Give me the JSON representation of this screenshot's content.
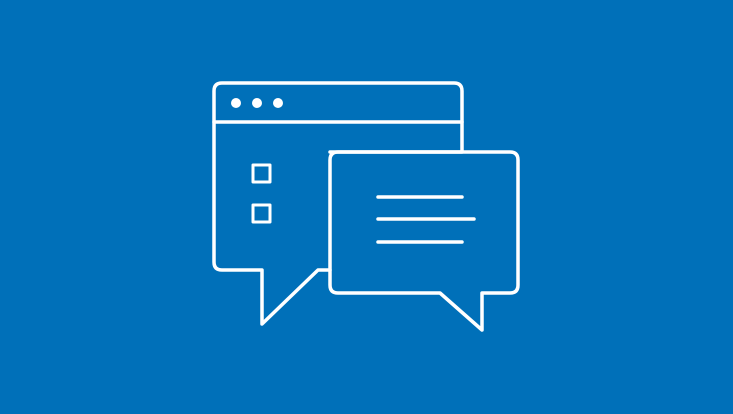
{
  "background_color": "#0070B9",
  "line_color": "#FFFFFF",
  "icon": "browser-window-and-chat-bubble-icon"
}
